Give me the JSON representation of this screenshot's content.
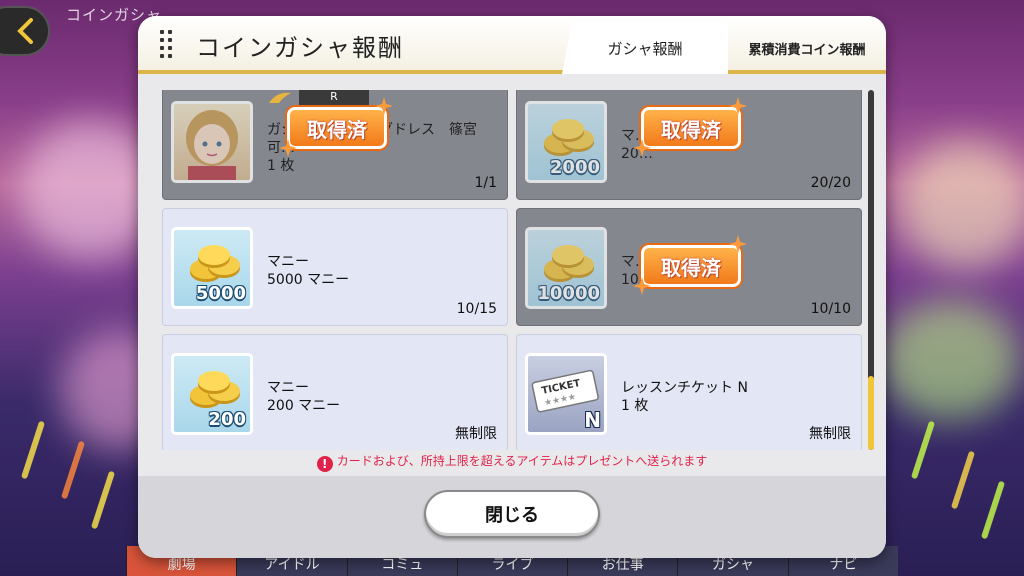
{
  "screen": {
    "title": "コインガシャ"
  },
  "bottom_nav": {
    "items": [
      "劇場",
      "アイドル",
      "コミュ",
      "ライブ",
      "お仕事",
      "ガシャ",
      "ナビ"
    ]
  },
  "dialog": {
    "title": "コインガシャ報酬",
    "tabs": [
      {
        "label": "ガシャ報酬",
        "active": true
      },
      {
        "label": "累積消費コイン報酬",
        "active": false
      }
    ],
    "rewards": [
      {
        "kind": "card",
        "rarity": "R",
        "name": "ガシャ　　　　ングドレス　篠宮",
        "desc": "可…",
        "qty": "1 枚",
        "count": "1/1",
        "claimed": true,
        "stamp": "取得済"
      },
      {
        "kind": "money",
        "coin_label": "2000",
        "name": "マ…",
        "desc": "20…",
        "count": "20/20",
        "claimed": true,
        "stamp": "取得済"
      },
      {
        "kind": "money",
        "coin_label": "5000",
        "name": "マニー",
        "desc": "5000 マニー",
        "count": "10/15",
        "claimed": false
      },
      {
        "kind": "money",
        "coin_label": "10000",
        "name": "マ…",
        "desc": "10…",
        "count": "10/10",
        "claimed": true,
        "stamp": "取得済"
      },
      {
        "kind": "money",
        "coin_label": "200",
        "name": "マニー",
        "desc": "200 マニー",
        "count": "無制限",
        "claimed": false
      },
      {
        "kind": "ticket",
        "ticket_text": "TICKET",
        "ticket_grade": "N",
        "name": "レッスンチケット N",
        "desc": "1 枚",
        "count": "無制限",
        "claimed": false
      }
    ],
    "notice": "カードおよび、所持上限を超えるアイテムはプレゼントへ送られます",
    "close_label": "閉じる"
  },
  "colors": {
    "accent_gold": "#dcb54a",
    "stamp_orange": "#f27a1a",
    "notice_red": "#e0224a"
  }
}
